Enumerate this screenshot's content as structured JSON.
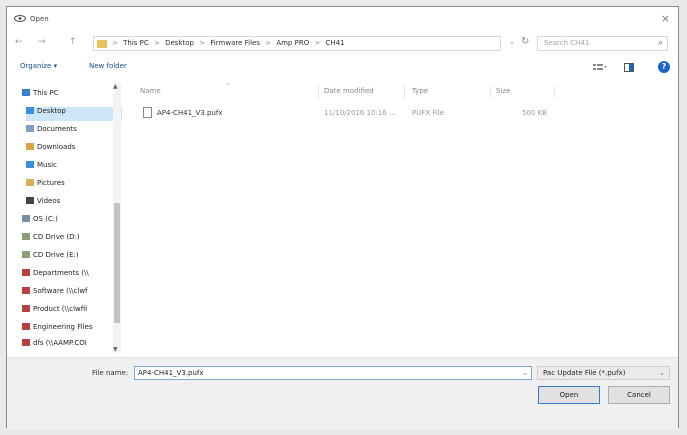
{
  "window": {
    "title": "Open",
    "close_glyph": "×"
  },
  "nav": {
    "back": "←",
    "forward": "→",
    "up": "↑"
  },
  "address": {
    "crumbs": [
      "This PC",
      "Desktop",
      "Firmware Files",
      "Amp PRO",
      "CH41"
    ],
    "separator": ">",
    "dropdown": "⌄",
    "refresh": "↻"
  },
  "search": {
    "placeholder": "Search CH41",
    "icon": "⌕"
  },
  "toolbar": {
    "organize": "Organize ▾",
    "new_folder": "New folder",
    "help": "?"
  },
  "sidebar": {
    "items": [
      {
        "label": "This PC",
        "icon": "computer-icon",
        "color": "#3a7fd0"
      },
      {
        "label": "Desktop",
        "icon": "desktop-folder-icon",
        "color": "#3a8fe0",
        "selected": true
      },
      {
        "label": "Documents",
        "icon": "documents-icon",
        "color": "#7aa0c8"
      },
      {
        "label": "Downloads",
        "icon": "downloads-icon",
        "color": "#d7a640"
      },
      {
        "label": "Music",
        "icon": "music-icon",
        "color": "#3a8fe0"
      },
      {
        "label": "Pictures",
        "icon": "pictures-icon",
        "color": "#d7b060"
      },
      {
        "label": "Videos",
        "icon": "videos-icon",
        "color": "#444444"
      },
      {
        "label": "OS (C:)",
        "icon": "drive-icon",
        "color": "#7a8fa0"
      },
      {
        "label": "CD Drive (D:)",
        "icon": "cd-drive-icon",
        "color": "#8aa070"
      },
      {
        "label": "CD Drive (E:)",
        "icon": "cd-drive-icon",
        "color": "#8aa070"
      },
      {
        "label": "Departments (\\\\",
        "icon": "network-drive-icon",
        "color": "#b84040"
      },
      {
        "label": "Software (\\\\clwf",
        "icon": "network-drive-icon",
        "color": "#b84040"
      },
      {
        "label": "Product (\\\\clwfil",
        "icon": "network-drive-icon",
        "color": "#b84040"
      },
      {
        "label": "Engineering Files",
        "icon": "network-drive-icon",
        "color": "#b84040"
      },
      {
        "label": "dfs (\\\\AAMP.COI",
        "icon": "network-drive-icon",
        "color": "#b84040"
      }
    ]
  },
  "files": {
    "columns": [
      "Name",
      "Date modified",
      "Type",
      "Size"
    ],
    "rows": [
      {
        "name": "AP4-CH41_V3.pufx",
        "date": "11/10/2016 10:16 ...",
        "type": "PUFX File",
        "size": "500 KB"
      }
    ]
  },
  "footer": {
    "filename_label": "File name:",
    "filename_value": "AP4-CH41_V3.pufx",
    "filetype_value": "Pac Update File (*.pufx)",
    "open_label": "Open",
    "cancel_label": "Cancel"
  }
}
